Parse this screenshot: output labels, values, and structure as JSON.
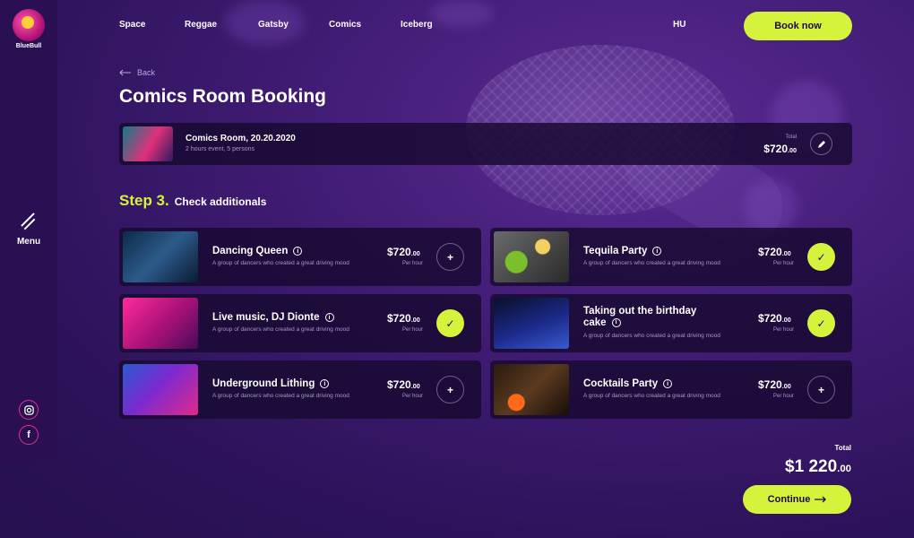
{
  "brand": {
    "name": "BlueBull"
  },
  "sidebar": {
    "menu_label": "Menu",
    "social": [
      "instagram-icon",
      "facebook-icon"
    ]
  },
  "nav": {
    "items": [
      "Space",
      "Reggae",
      "Gatsby",
      "Comics",
      "Iceberg"
    ],
    "language": "HU",
    "book_now": "Book now"
  },
  "page": {
    "back_label": "Back",
    "title": "Comics Room Booking"
  },
  "summary": {
    "title": "Comics Room, 20.20.2020",
    "subtitle": "2 hours event, 5 persons",
    "total_label": "Total",
    "total_main": "$720",
    "total_cents": ".00"
  },
  "step": {
    "number": "Step 3.",
    "label": "Check additionals"
  },
  "additionals": [
    {
      "name": "Dancing Queen",
      "desc": "A group of dancers who created a great driving mood",
      "price": "$720",
      "cents": ".00",
      "unit": "Per hour",
      "selected": false
    },
    {
      "name": "Tequila Party",
      "desc": "A group of dancers who created a great driving mood",
      "price": "$720",
      "cents": ".00",
      "unit": "Per hour",
      "selected": true
    },
    {
      "name": "Live music, DJ Dionte",
      "desc": "A group of dancers who created a great driving mood",
      "price": "$720",
      "cents": ".00",
      "unit": "Per hour",
      "selected": true
    },
    {
      "name_line1": "Taking out the birthday",
      "name_line2": "cake",
      "desc": "A group of dancers who created a great driving mood",
      "price": "$720",
      "cents": ".00",
      "unit": "Per hour",
      "selected": true
    },
    {
      "name": "Underground Lithing",
      "desc": "A group of dancers who created a great driving mood",
      "price": "$720",
      "cents": ".00",
      "unit": "Per hour",
      "selected": false
    },
    {
      "name": "Cocktails Party",
      "desc": "A group of dancers who created a great driving mood",
      "price": "$720",
      "cents": ".00",
      "unit": "Per hour",
      "selected": false
    }
  ],
  "footer": {
    "total_label": "Total",
    "total_main": "$1 220",
    "total_cents": ".00",
    "continue": "Continue"
  },
  "colors": {
    "accent": "#d6f33b",
    "background": "#3f1b72",
    "card": "#190a32",
    "social_ring": "#e0338f"
  }
}
